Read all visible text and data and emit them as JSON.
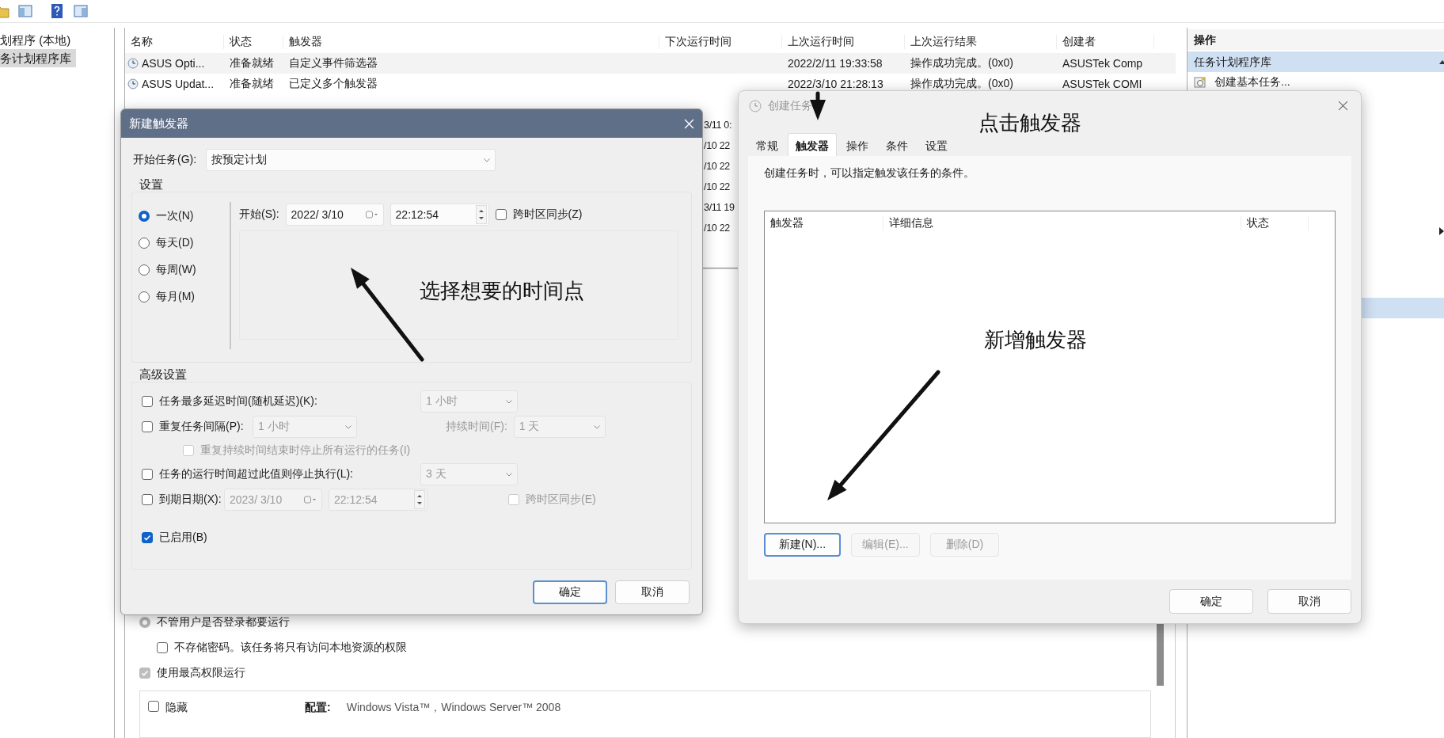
{
  "tree": {
    "items": [
      {
        "label": "划程序 (本地)",
        "selected": false,
        "children": [
          {
            "label": "务计划程序库",
            "selected": true
          }
        ]
      }
    ]
  },
  "task_list": {
    "columns": [
      "名称",
      "状态",
      "触发器",
      "下次运行时间",
      "上次运行时间",
      "上次运行结果",
      "创建者"
    ],
    "rows": [
      {
        "kind": "task",
        "name": "ASUS Opti...",
        "status": "准备就绪",
        "trigger": "自定义事件筛选器",
        "last_run": "2022/2/11 19:33:58",
        "last_result": "操作成功完成。(0x0)",
        "author": "ASUSTek Comp"
      },
      {
        "kind": "task",
        "name": "ASUS Updat...",
        "status": "准备就绪",
        "trigger": "已定义多个触发器",
        "last_run": "2022/3/10 21:28:13",
        "last_result": "操作成功完成。(0x0)",
        "author": "ASUSTek COMI"
      }
    ],
    "fragments": [
      "3/11 0:",
      "/10 22",
      "/10 22",
      "/10 22",
      "3/11 19",
      "/10 22"
    ]
  },
  "general_settings": {
    "items": [
      {
        "kind": "radio",
        "label": "不管用户是否登录都要运行",
        "selected": true,
        "disabled": true,
        "children": [
          {
            "kind": "checkbox",
            "label": "不存储密码。该任务将只有访问本地资源的权限",
            "checked": false,
            "disabled": false
          }
        ]
      },
      {
        "kind": "checkbox",
        "label": "使用最高权限运行",
        "checked": true,
        "disabled": true
      }
    ],
    "last_row": {
      "hidden": {
        "label": "隐藏",
        "checked": false
      },
      "configure_label": "配置:",
      "configure_value": "Windows Vista™，Windows Server™ 2008"
    }
  },
  "actions_panel": {
    "title": "操作",
    "sections": [
      {
        "label": "任务计划程序库",
        "expanded": true,
        "items": [
          {
            "label": "创建基本任务..."
          }
        ]
      }
    ]
  },
  "new_trigger_dialog": {
    "title": "新建触发器",
    "begin_task": {
      "label": "开始任务(G):",
      "value": "按预定计划"
    },
    "settings": {
      "title": "设置",
      "schedules": [
        {
          "label": "一次(N)",
          "selected": true
        },
        {
          "label": "每天(D)",
          "selected": false
        },
        {
          "label": "每周(W)",
          "selected": false
        },
        {
          "label": "每月(M)",
          "selected": false
        }
      ],
      "start": {
        "label": "开始(S):",
        "date": "2022/ 3/10",
        "time": "22:12:54",
        "sync": {
          "label": "跨时区同步(Z)",
          "checked": false
        }
      }
    },
    "advanced": {
      "title": "高级设置",
      "delay": {
        "label": "任务最多延迟时间(随机延迟)(K):",
        "checked": false,
        "value": "1 小时"
      },
      "repeat": {
        "label": "重复任务间隔(P):",
        "checked": false,
        "value": "1 小时",
        "duration_label": "持续时间(F):",
        "duration_value": "1 天",
        "stop_all": {
          "label": "重复持续时间结束时停止所有运行的任务(I)",
          "checked": false
        }
      },
      "stop_after": {
        "label": "任务的运行时间超过此值则停止执行(L):",
        "checked": false,
        "value": "3 天"
      },
      "expire": {
        "label": "到期日期(X):",
        "checked": false,
        "date": "2023/ 3/10",
        "time": "22:12:54",
        "sync": {
          "label": "跨时区同步(E)",
          "checked": false
        }
      },
      "enabled": {
        "label": "已启用(B)",
        "checked": true
      }
    },
    "buttons": [
      {
        "label": "确定",
        "focused": true
      },
      {
        "label": "取消",
        "focused": false
      }
    ]
  },
  "create_task_dialog": {
    "title": "创建任务",
    "active": false,
    "tabs": [
      {
        "label": "常规",
        "selected": false
      },
      {
        "label": "触发器",
        "selected": true
      },
      {
        "label": "操作",
        "selected": false
      },
      {
        "label": "条件",
        "selected": false
      },
      {
        "label": "设置",
        "selected": false
      }
    ],
    "description": "创建任务时，可以指定触发该任务的条件。",
    "trigger_list": {
      "columns": [
        "触发器",
        "详细信息",
        "状态"
      ]
    },
    "buttons": [
      {
        "label": "新建(N)...",
        "disabled": false,
        "focused": true
      },
      {
        "label": "编辑(E)...",
        "disabled": true,
        "focused": false
      },
      {
        "label": "删除(D)",
        "disabled": true,
        "focused": false
      }
    ],
    "footer_buttons": [
      {
        "label": "确定"
      },
      {
        "label": "取消"
      }
    ]
  },
  "annotations": [
    {
      "text": "点击触发器"
    },
    {
      "text": "选择想要的时间点"
    },
    {
      "text": "新增触发器"
    }
  ]
}
